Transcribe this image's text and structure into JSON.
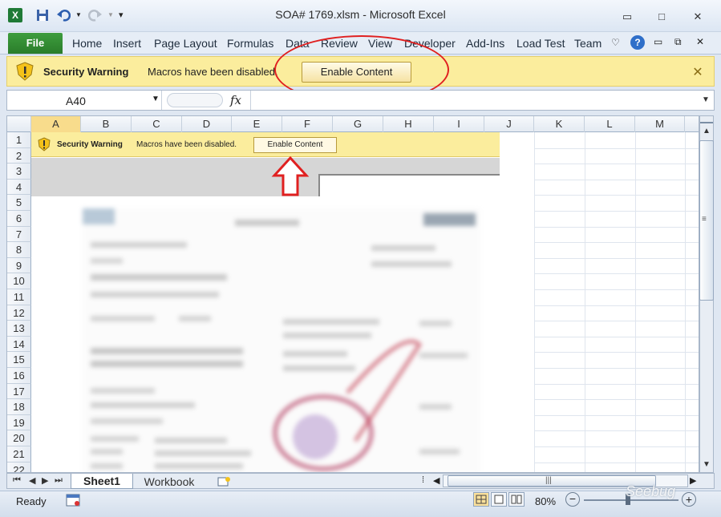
{
  "window": {
    "title": "SOA# 1769.xlsm  -  Microsoft Excel",
    "minimize": "▭",
    "maximize": "□",
    "close": "✕"
  },
  "ribbon": {
    "file": "File",
    "tabs": [
      "Home",
      "Insert",
      "Page Layout",
      "Formulas",
      "Data",
      "Review",
      "View",
      "Developer",
      "Add-Ins",
      "Load Test",
      "Team"
    ]
  },
  "security_warning": {
    "title": "Security Warning",
    "message": "Macros have been disabled.",
    "button": "Enable Content",
    "close": "✕"
  },
  "formula_bar": {
    "name_box": "A40",
    "fx": "fx",
    "value": ""
  },
  "grid": {
    "columns": [
      "A",
      "B",
      "C",
      "D",
      "E",
      "F",
      "G",
      "H",
      "I",
      "J",
      "K",
      "L",
      "M"
    ],
    "rows": [
      "1",
      "2",
      "3",
      "4",
      "5",
      "6",
      "7",
      "8",
      "9",
      "10",
      "11",
      "12",
      "13",
      "14",
      "15",
      "16",
      "17",
      "18",
      "19",
      "20",
      "21",
      "22"
    ]
  },
  "embedded_image": {
    "title": "Security Warning",
    "message": "Macros have been disabled.",
    "button": "Enable Content"
  },
  "sheets": {
    "active": "Sheet1",
    "other": "Workbook"
  },
  "status": {
    "ready": "Ready",
    "zoom": "80%",
    "zoom_minus": "−",
    "zoom_plus": "+"
  },
  "watermark": "Seebug",
  "colors": {
    "warning_bg": "#fbed9d",
    "annotation_red": "#e02020",
    "file_tab": "#2a7d2a"
  }
}
